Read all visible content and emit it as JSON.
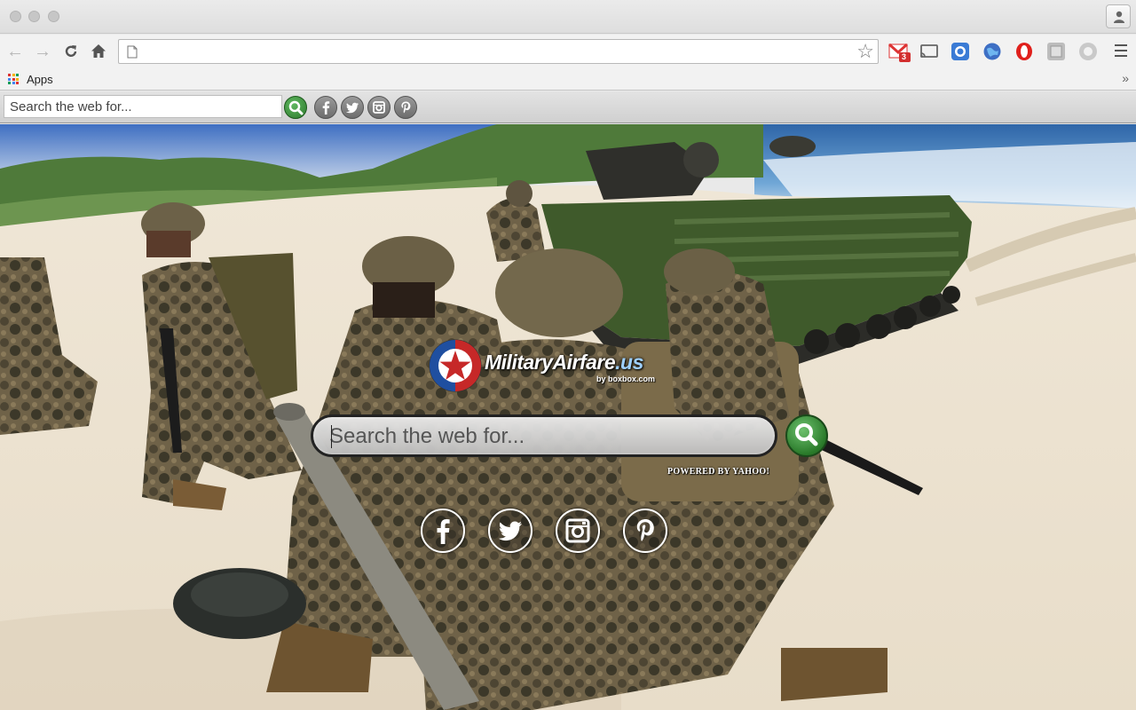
{
  "browser": {
    "address_bar": {
      "value": "",
      "placeholder": ""
    },
    "bookmarks": {
      "apps_label": "Apps",
      "overflow": "»"
    },
    "extensions": [
      {
        "icon": "gmail-icon",
        "badge": "3"
      },
      {
        "icon": "cast-icon"
      },
      {
        "icon": "extension-blue-icon"
      },
      {
        "icon": "globe-icon"
      },
      {
        "icon": "opera-icon"
      },
      {
        "icon": "extension-gray-icon"
      },
      {
        "icon": "extension-circle-icon"
      }
    ]
  },
  "toolbar_extension": {
    "search_placeholder": "Search the web for...",
    "social": [
      "facebook",
      "twitter",
      "instagram",
      "pinterest"
    ]
  },
  "page": {
    "logo": {
      "name": "MilitaryAirfare",
      "tld": ".us",
      "sub": "by boxbox.com"
    },
    "search": {
      "placeholder": "Search the web for..."
    },
    "powered_by": "POWERED BY YAHOO!",
    "social": [
      "facebook",
      "twitter",
      "instagram",
      "pinterest"
    ],
    "colors": {
      "search_button": "#2e7d32",
      "logo_blue": "#1f4fa0",
      "logo_red": "#c62828"
    }
  }
}
